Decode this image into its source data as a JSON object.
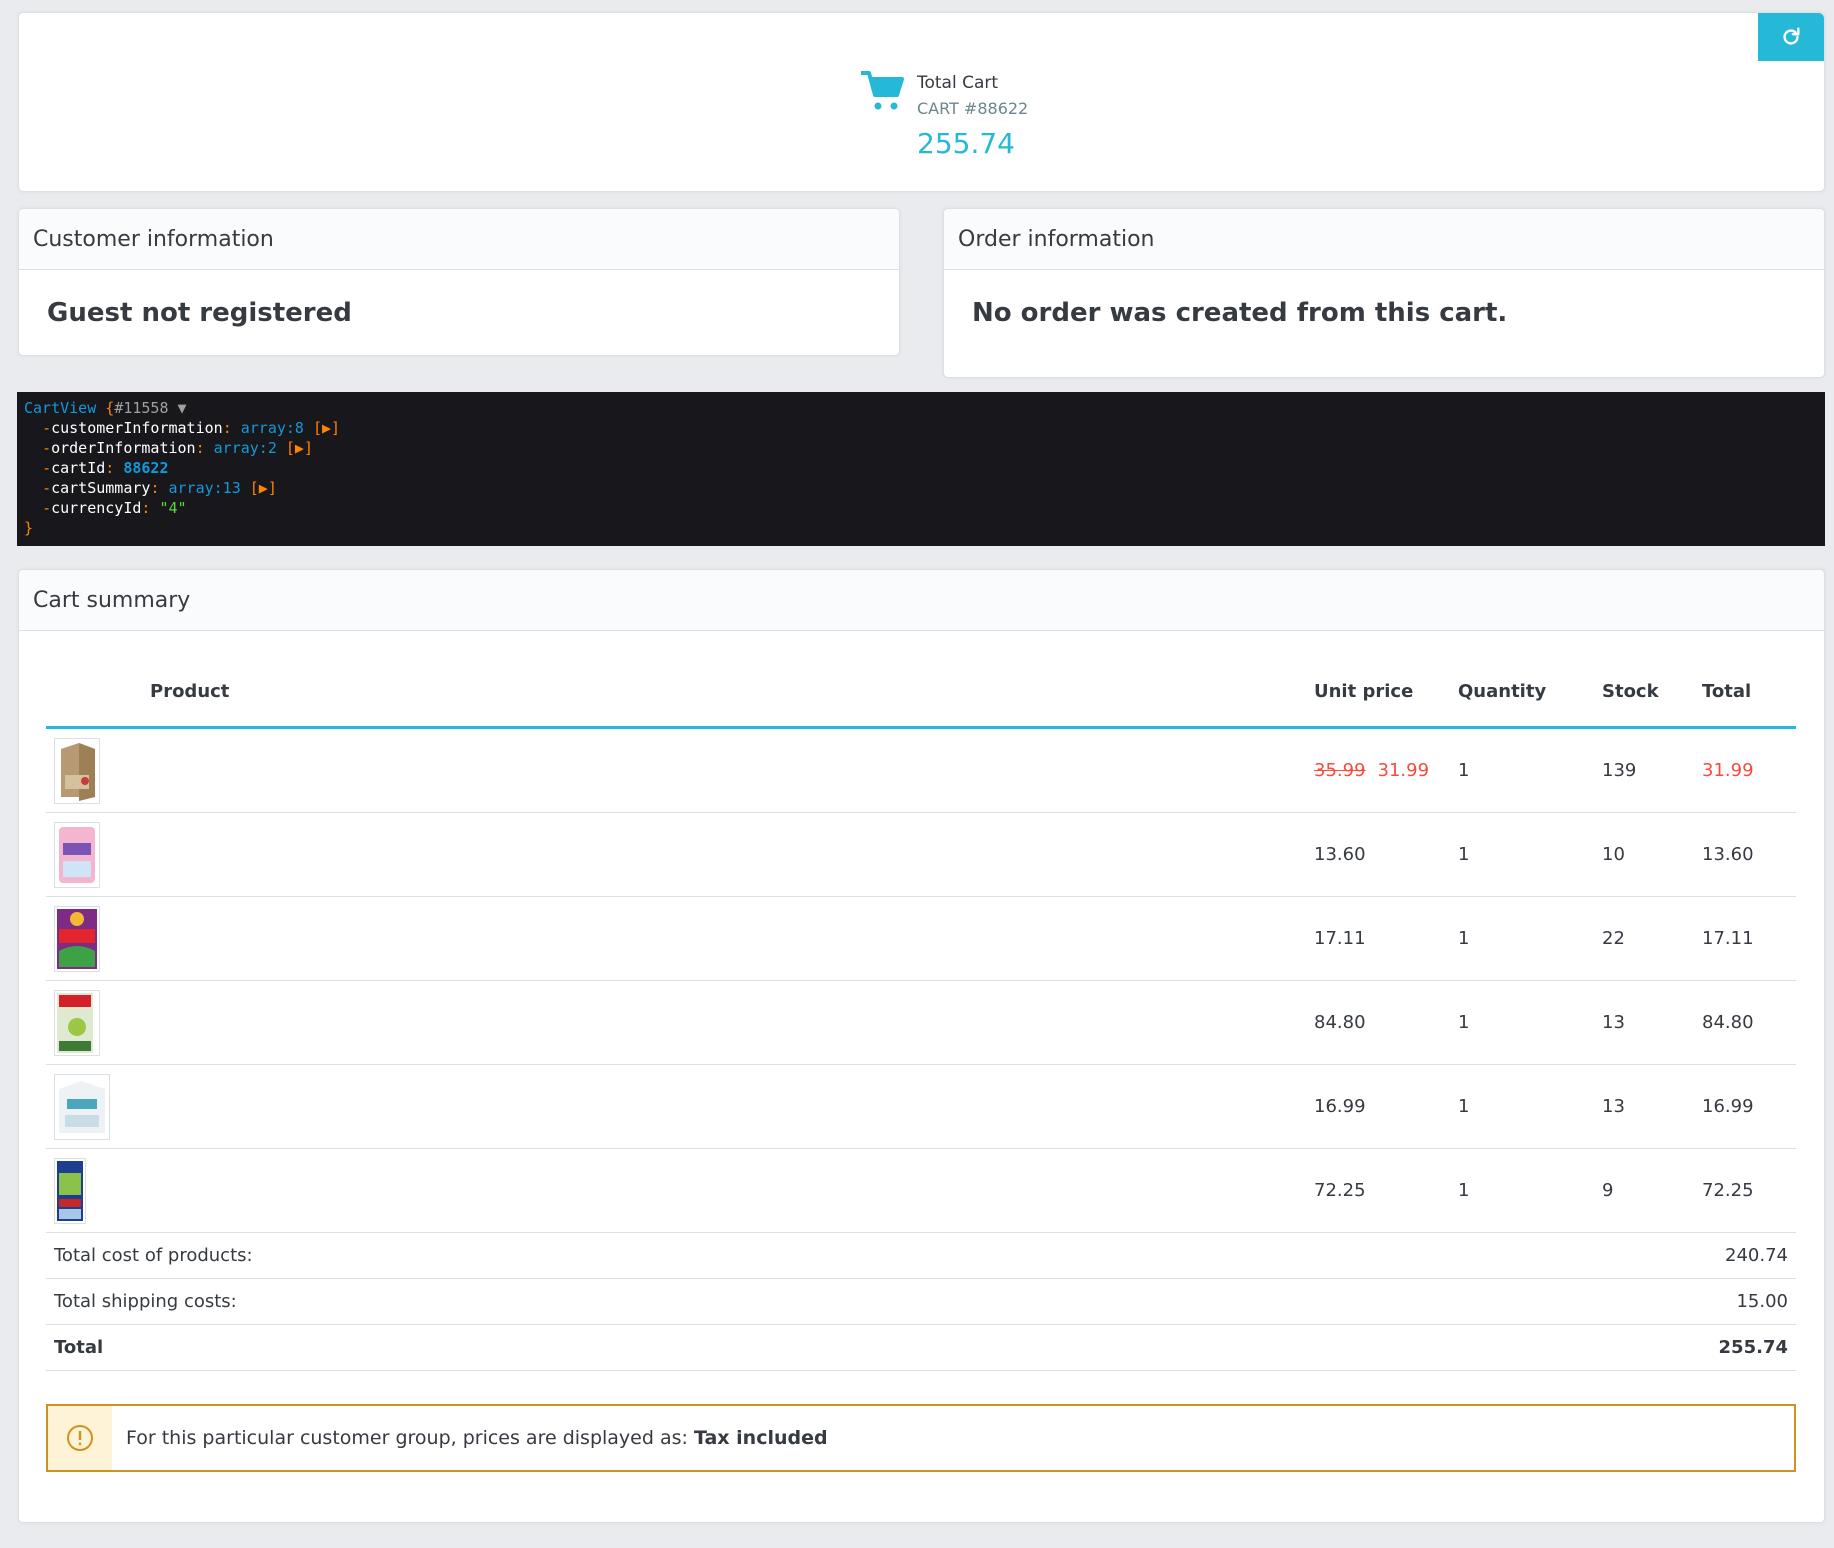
{
  "top": {
    "total_cart_label": "Total Cart",
    "cart_id": "CART #88622",
    "amount": "255.74",
    "refresh_icon": "refresh-icon",
    "cart_icon": "shopping-cart-icon"
  },
  "customer": {
    "title": "Customer information",
    "message": "Guest not registered"
  },
  "order": {
    "title": "Order information",
    "message": "No order was created from this cart."
  },
  "dump": {
    "class_name": "CartView",
    "object_id": "#11558",
    "collapse_glyph": "▼",
    "lines": [
      {
        "key": "customerInformation",
        "value": "array:8",
        "toggle": "[▶]"
      },
      {
        "key": "orderInformation",
        "value": "array:2",
        "toggle": "[▶]"
      },
      {
        "key": "cartId",
        "value": "88622"
      },
      {
        "key": "cartSummary",
        "value": "array:13",
        "toggle": "[▶]"
      },
      {
        "key": "currencyId",
        "value": "\"4\""
      }
    ]
  },
  "summary": {
    "title": "Cart summary",
    "headers": {
      "product": "Product",
      "unit_price": "Unit price",
      "quantity": "Quantity",
      "stock": "Stock",
      "total": "Total"
    },
    "rows": [
      {
        "old_price": "35.99",
        "unit_price": "31.99",
        "quantity": "1",
        "stock": "139",
        "total": "31.99",
        "discounted": true
      },
      {
        "unit_price": "13.60",
        "quantity": "1",
        "stock": "10",
        "total": "13.60"
      },
      {
        "unit_price": "17.11",
        "quantity": "1",
        "stock": "22",
        "total": "17.11"
      },
      {
        "unit_price": "84.80",
        "quantity": "1",
        "stock": "13",
        "total": "84.80"
      },
      {
        "unit_price": "16.99",
        "quantity": "1",
        "stock": "13",
        "total": "16.99"
      },
      {
        "unit_price": "72.25",
        "quantity": "1",
        "stock": "9",
        "total": "72.25"
      }
    ],
    "totals": {
      "products_label": "Total cost of products:",
      "products_value": "240.74",
      "shipping_label": "Total shipping costs:",
      "shipping_value": "15.00",
      "total_label": "Total",
      "total_value": "255.74"
    },
    "alert": {
      "text": "For this particular customer group, prices are displayed as: ",
      "strong": "Tax included",
      "icon": "warning-icon"
    }
  },
  "colors": {
    "accent": "#25b9d7",
    "discount": "#f54c3e",
    "warning": "#cd9321"
  }
}
